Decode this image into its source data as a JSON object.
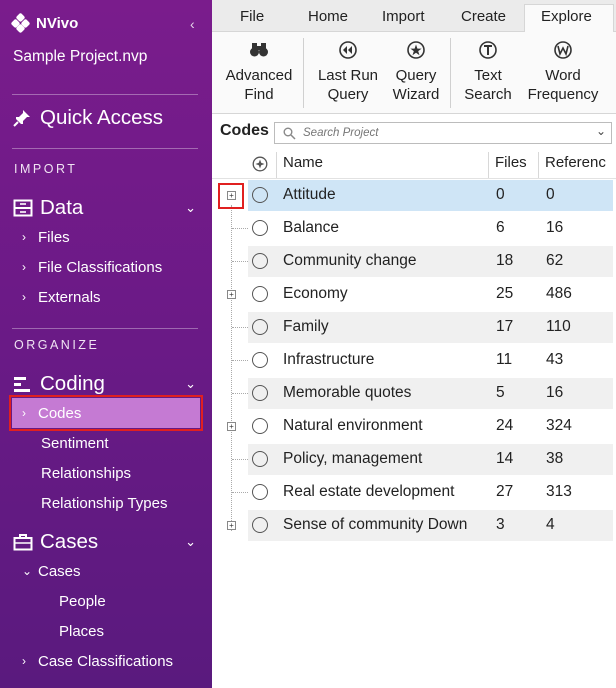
{
  "app": {
    "name": "NVivo",
    "project": "Sample Project.nvp",
    "collapse_glyph": "‹"
  },
  "sidebar": {
    "quick_access": "Quick Access",
    "import_label": "IMPORT",
    "data_label": "Data",
    "data_items": [
      "Files",
      "File Classifications",
      "Externals"
    ],
    "organize_label": "ORGANIZE",
    "coding_label": "Coding",
    "coding_items": {
      "codes": "Codes",
      "sentiment": "Sentiment",
      "relationships": "Relationships",
      "relationship_types": "Relationship Types"
    },
    "cases_label": "Cases",
    "cases_items": {
      "cases": "Cases",
      "people": "People",
      "places": "Places",
      "case_classifications": "Case Classifications"
    },
    "arrow_right": "›",
    "arrow_down": "⌄"
  },
  "ribbon": {
    "tabs": [
      "File",
      "Home",
      "Import",
      "Create",
      "Explore"
    ],
    "active_tab": "Explore",
    "buttons": [
      {
        "line1": "Advanced",
        "line2": "Find",
        "icon": "binoculars-icon"
      },
      {
        "line1": "Last Run",
        "line2": "Query",
        "icon": "rewind-icon"
      },
      {
        "line1": "Query",
        "line2": "Wizard",
        "icon": "wand-icon"
      },
      {
        "line1": "Text",
        "line2": "Search",
        "icon": "text-search-icon"
      },
      {
        "line1": "Word",
        "line2": "Frequency",
        "icon": "word-frequency-icon"
      }
    ]
  },
  "codes_panel": {
    "title": "Codes",
    "search_placeholder": "Search Project",
    "columns": {
      "name": "Name",
      "files": "Files",
      "references": "Referenc"
    },
    "rows": [
      {
        "name": "Attitude",
        "files": "0",
        "references": "0",
        "expandable": true,
        "selected": true
      },
      {
        "name": "Balance",
        "files": "6",
        "references": "16",
        "expandable": false
      },
      {
        "name": "Community change",
        "files": "18",
        "references": "62",
        "expandable": false
      },
      {
        "name": "Economy",
        "files": "25",
        "references": "486",
        "expandable": true
      },
      {
        "name": "Family",
        "files": "17",
        "references": "110",
        "expandable": false
      },
      {
        "name": "Infrastructure",
        "files": "11",
        "references": "43",
        "expandable": false
      },
      {
        "name": "Memorable quotes",
        "files": "5",
        "references": "16",
        "expandable": false
      },
      {
        "name": "Natural environment",
        "files": "24",
        "references": "324",
        "expandable": true
      },
      {
        "name": "Policy, management",
        "files": "14",
        "references": "38",
        "expandable": false
      },
      {
        "name": "Real estate development",
        "files": "27",
        "references": "313",
        "expandable": false
      },
      {
        "name": "Sense of community Down",
        "files": "3",
        "references": "4",
        "expandable": true
      }
    ]
  },
  "colors": {
    "sidebar": "#6a1a86",
    "selected_nav": "#c57ad3",
    "selected_row": "#cfe5f6",
    "highlight": "#e02020"
  }
}
